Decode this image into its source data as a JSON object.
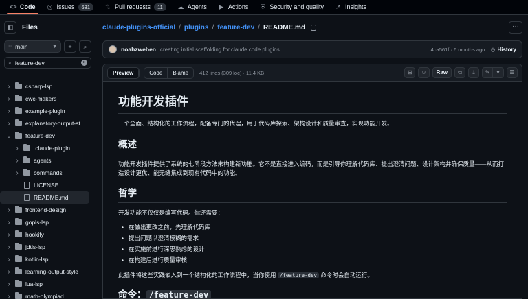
{
  "nav": {
    "tabs": [
      {
        "label": "Code",
        "icon": "code-icon",
        "glyph": "<>",
        "count": ""
      },
      {
        "label": "Issues",
        "icon": "issue-icon",
        "glyph": "◎",
        "count": "681"
      },
      {
        "label": "Pull requests",
        "icon": "pull-request-icon",
        "glyph": "⇅",
        "count": "11"
      },
      {
        "label": "Agents",
        "icon": "agents-icon",
        "glyph": "☁",
        "count": ""
      },
      {
        "label": "Actions",
        "icon": "play-icon",
        "glyph": "▶",
        "count": ""
      },
      {
        "label": "Security and quality",
        "icon": "shield-icon",
        "glyph": "⛨",
        "count": ""
      },
      {
        "label": "Insights",
        "icon": "graph-icon",
        "glyph": "↗",
        "count": ""
      }
    ]
  },
  "sidebar": {
    "title": "Files",
    "branch": "main",
    "search_value": "feature-dev",
    "tree": [
      {
        "label": "csharp-lsp",
        "type": "folder",
        "depth": 0,
        "expanded": false,
        "selected": false
      },
      {
        "label": "cwc-makers",
        "type": "folder",
        "depth": 0,
        "expanded": false,
        "selected": false
      },
      {
        "label": "example-plugin",
        "type": "folder",
        "depth": 0,
        "expanded": false,
        "selected": false
      },
      {
        "label": "explanatory-output-st...",
        "type": "folder",
        "depth": 0,
        "expanded": false,
        "selected": false
      },
      {
        "label": "feature-dev",
        "type": "folder",
        "depth": 0,
        "expanded": true,
        "selected": false
      },
      {
        "label": ".claude-plugin",
        "type": "folder",
        "depth": 1,
        "expanded": false,
        "selected": false
      },
      {
        "label": "agents",
        "type": "folder",
        "depth": 1,
        "expanded": false,
        "selected": false
      },
      {
        "label": "commands",
        "type": "folder",
        "depth": 1,
        "expanded": false,
        "selected": false
      },
      {
        "label": "LICENSE",
        "type": "file",
        "depth": 1,
        "expanded": false,
        "selected": false
      },
      {
        "label": "README.md",
        "type": "file",
        "depth": 1,
        "expanded": false,
        "selected": true
      },
      {
        "label": "frontend-design",
        "type": "folder",
        "depth": 0,
        "expanded": false,
        "selected": false
      },
      {
        "label": "gopls-lsp",
        "type": "folder",
        "depth": 0,
        "expanded": false,
        "selected": false
      },
      {
        "label": "hookify",
        "type": "folder",
        "depth": 0,
        "expanded": false,
        "selected": false
      },
      {
        "label": "jdtls-lsp",
        "type": "folder",
        "depth": 0,
        "expanded": false,
        "selected": false
      },
      {
        "label": "kotlin-lsp",
        "type": "folder",
        "depth": 0,
        "expanded": false,
        "selected": false
      },
      {
        "label": "learning-output-style",
        "type": "folder",
        "depth": 0,
        "expanded": false,
        "selected": false
      },
      {
        "label": "lua-lsp",
        "type": "folder",
        "depth": 0,
        "expanded": false,
        "selected": false
      },
      {
        "label": "math-olympiad",
        "type": "folder",
        "depth": 0,
        "expanded": false,
        "selected": false
      }
    ]
  },
  "breadcrumb": {
    "parts": [
      "claude-plugins-official",
      "plugins",
      "feature-dev"
    ],
    "current": "README.md"
  },
  "commit": {
    "author": "noahzweben",
    "message": "creating initial scaffolding for claude code plugins",
    "meta": "4ca561f · 6 months ago",
    "history_label": "History"
  },
  "file_header": {
    "preview_label": "Preview",
    "code_label": "Code",
    "blame_label": "Blame",
    "info": "412 lines (309 loc) · 11.4 KB",
    "raw_label": "Raw"
  },
  "readme": {
    "title": "功能开发插件",
    "intro": "一个全面、结构化的工作流程，配备专门的代理，用于代码库探索、架构设计和质量审查，实现功能开发。",
    "overview_heading": "概述",
    "overview_text": "功能开发插件提供了系统的七阶段方法来构建新功能。它不是直接进入编码，而是引导你理解代码库、提出澄清问题、设计架构并确保质量——从而打造设计更优、能无缝集成到现有代码中的功能。",
    "philosophy_heading": "哲学",
    "philosophy_text": "开发功能不仅仅是编写代码。你还需要：",
    "bullets": [
      "在做出更改之前，先理解代码库",
      "提出问题以澄清模糊的需求",
      "在实施前进行深思熟虑的设计",
      "在构建后进行质量审核"
    ],
    "usage_before": "此插件将这些实践嵌入到一个结构化的工作流程中，当你使用 ",
    "usage_code": "/feature-dev",
    "usage_after": " 命令时会自动运行。",
    "command_heading": "命令：",
    "command_code": "/feature-dev"
  }
}
